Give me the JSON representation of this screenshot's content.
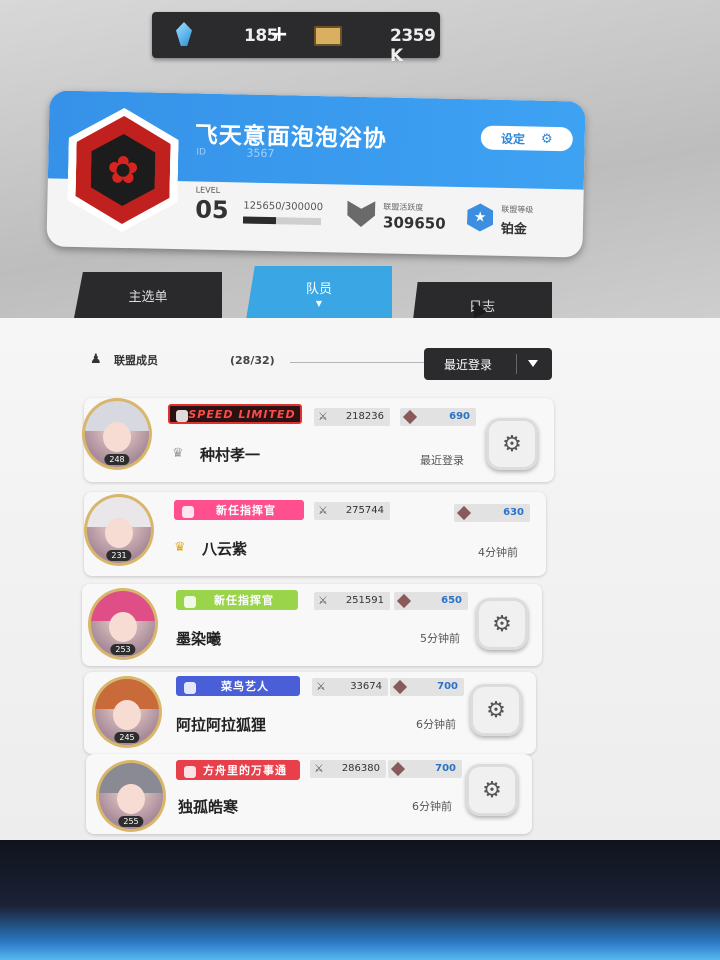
{
  "resources": {
    "gems": "185",
    "add": "+",
    "credits": "2359 K"
  },
  "union": {
    "name": "飞天意面泡泡浴协",
    "id_label": "ID",
    "id": "3567",
    "settings_label": "设定",
    "level_label": "LEVEL",
    "level": "05",
    "exp": "125650/300000",
    "exp_progress": 0.42,
    "activity_label": "联盟活跃度",
    "activity": "309650",
    "rank_label": "联盟等级",
    "rank": "铂金"
  },
  "tabs": {
    "main": "主选单",
    "members": "队员",
    "members_caret": "▼",
    "log": "日志"
  },
  "members_header": {
    "label": "联盟成员",
    "count": "(28/32)",
    "sort": "最近登录"
  },
  "members": [
    {
      "name": "种村孝一",
      "level": "248",
      "badge": "SPEED LIMITED",
      "power": "218236",
      "diamonds": "690",
      "last_login": "最近登录",
      "crown": "gray"
    },
    {
      "name": "八云紫",
      "level": "231",
      "badge": "新任指挥官",
      "power": "275744",
      "diamonds": "630",
      "last_login": "4分钟前",
      "crown": "gold"
    },
    {
      "name": "墨染曦",
      "level": "253",
      "badge": "新任指挥官",
      "power": "251591",
      "diamonds": "650",
      "last_login": "5分钟前",
      "crown": "none"
    },
    {
      "name": "阿拉阿拉狐狸",
      "level": "245",
      "badge": "菜鸟艺人",
      "power": "33674",
      "diamonds": "700",
      "last_login": "6分钟前",
      "crown": "none"
    },
    {
      "name": "独孤皓寒",
      "level": "255",
      "badge": "方舟里的万事通",
      "power": "286380",
      "diamonds": "700",
      "last_login": "6分钟前",
      "crown": "none"
    }
  ],
  "icons": {
    "crystal": "crystal-icon",
    "ticket": "ticket-icon",
    "gear": "⚙",
    "flower": "✿",
    "sword": "⚔",
    "star": "★",
    "crown": "♛"
  },
  "colors": {
    "accent_blue": "#3aa7e4",
    "emblem_red": "#c0201e",
    "dark": "#2b2b2e"
  }
}
